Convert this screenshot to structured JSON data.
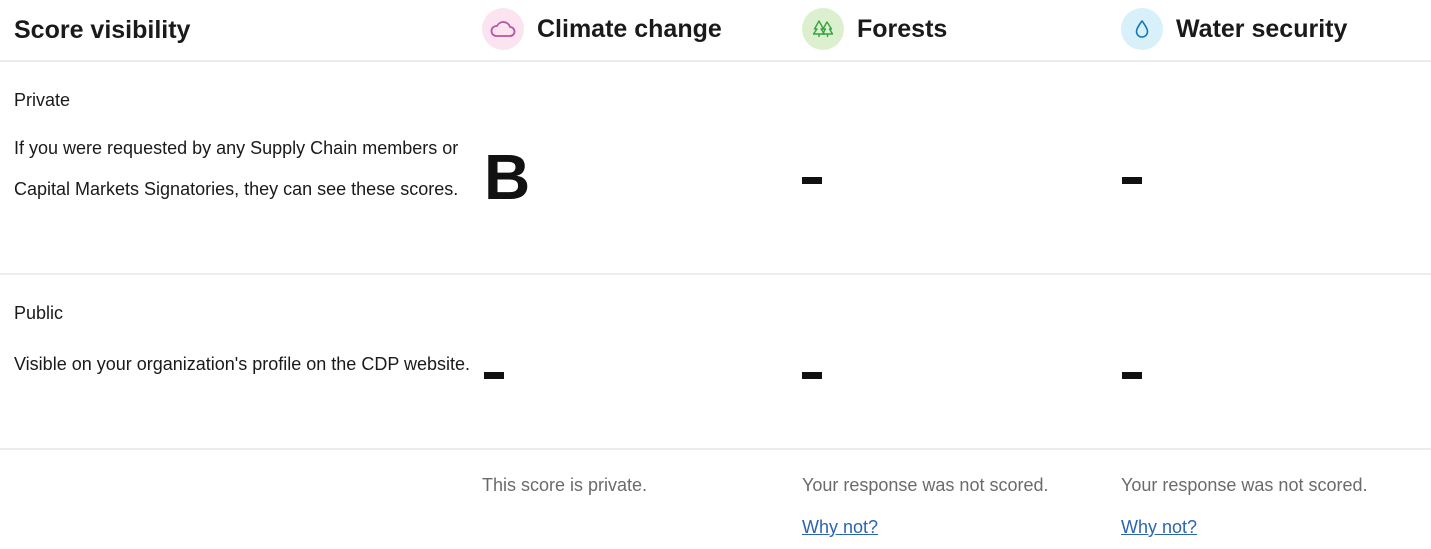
{
  "header": {
    "title": "Score visibility",
    "columns": [
      {
        "label": "Climate change",
        "icon": "cloud-icon",
        "badge_color": "#fbe4f0",
        "icon_color": "#b455a6"
      },
      {
        "label": "Forests",
        "icon": "trees-icon",
        "badge_color": "#dcf0cf",
        "icon_color": "#3aa142"
      },
      {
        "label": "Water security",
        "icon": "water-drop-icon",
        "badge_color": "#d8f0fa",
        "icon_color": "#1578b8"
      }
    ]
  },
  "rows": [
    {
      "label": "Private",
      "description": "If you were requested by any Supply Chain members or Capital Markets Signatories, they can see these scores.",
      "scores": [
        "B",
        "",
        ""
      ]
    },
    {
      "label": "Public",
      "description": "Visible on your organization's profile on the CDP website.",
      "scores": [
        "",
        "",
        ""
      ]
    }
  ],
  "footer": {
    "notes": [
      "This score is private.",
      "Your response was not scored.",
      "Your response was not scored."
    ],
    "why_not_label": "Why not?"
  }
}
